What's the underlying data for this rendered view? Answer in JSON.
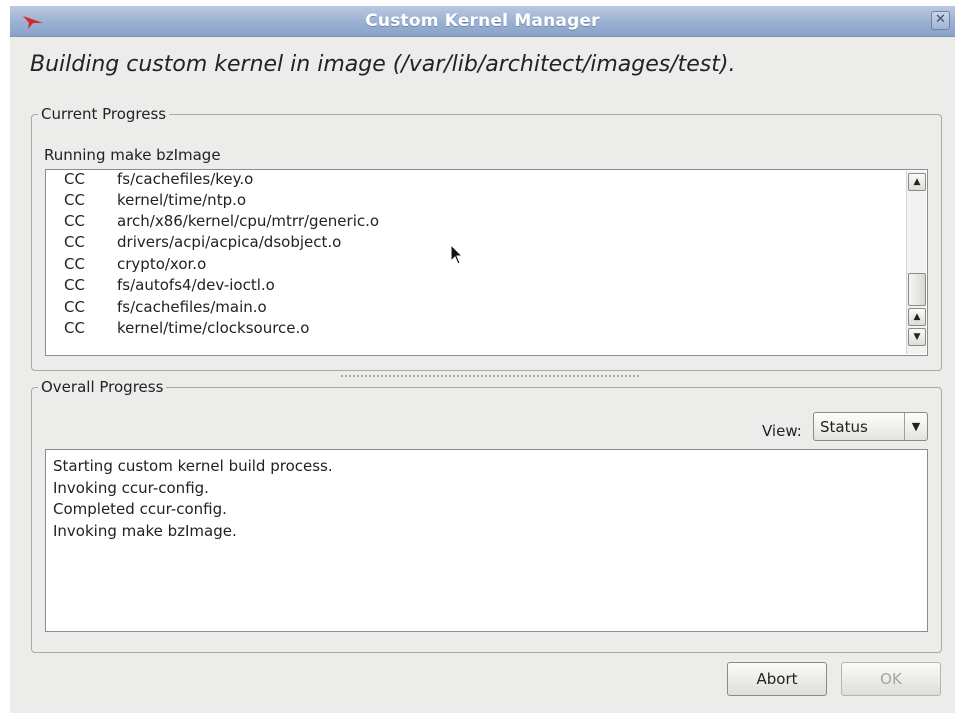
{
  "window": {
    "title": "Custom Kernel Manager",
    "close_glyph": "✕"
  },
  "heading": "Building custom kernel in image (/var/lib/architect/images/test).",
  "current_progress": {
    "legend": "Current Progress",
    "status_label": "Running make bzImage",
    "log": [
      {
        "cmd": "CC",
        "file": "fs/cachefiles/key.o"
      },
      {
        "cmd": "CC",
        "file": "kernel/time/ntp.o"
      },
      {
        "cmd": "CC",
        "file": "arch/x86/kernel/cpu/mtrr/generic.o"
      },
      {
        "cmd": "CC",
        "file": "drivers/acpi/acpica/dsobject.o"
      },
      {
        "cmd": "CC",
        "file": "crypto/xor.o"
      },
      {
        "cmd": "CC",
        "file": "fs/autofs4/dev-ioctl.o"
      },
      {
        "cmd": "CC",
        "file": "fs/cachefiles/main.o"
      },
      {
        "cmd": "CC",
        "file": "kernel/time/clocksource.o"
      }
    ]
  },
  "overall_progress": {
    "legend": "Overall Progress",
    "view_label": "View:",
    "view_selected": "Status",
    "status_lines": [
      "Starting custom kernel build process.",
      "Invoking ccur-config.",
      "Completed ccur-config.",
      "Invoking make bzImage."
    ]
  },
  "buttons": {
    "abort": "Abort",
    "ok": "OK"
  },
  "icons": {
    "app": "redhawk-icon",
    "close": "close-icon",
    "scroll_up": "arrow-up-icon",
    "scroll_down": "arrow-down-icon",
    "dropdown": "chevron-down-icon",
    "cursor": "mouse-pointer-icon"
  },
  "colors": {
    "titlebar": "#9ab0d2",
    "window_bg": "#ececea",
    "app_icon": "#d22a2a"
  }
}
